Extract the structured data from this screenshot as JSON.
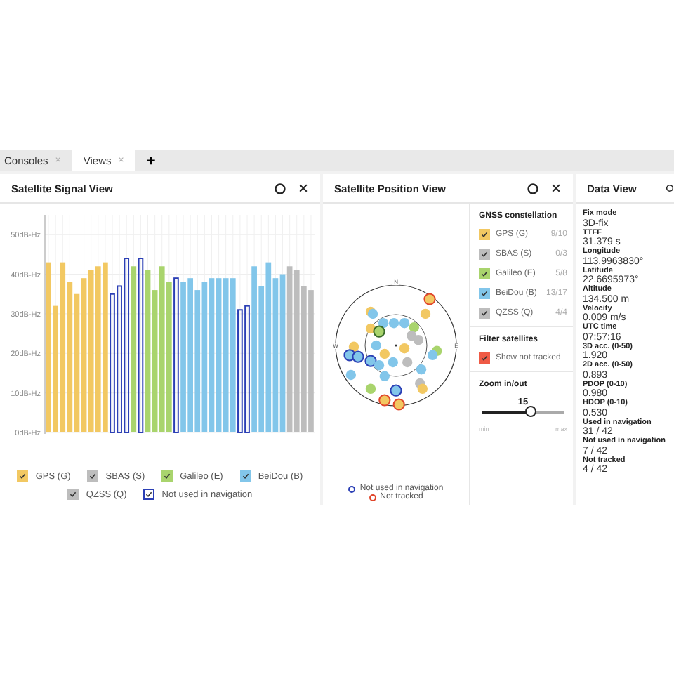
{
  "tabs": [
    {
      "label": "Consoles",
      "close": "×",
      "selected": false
    },
    {
      "label": "Views",
      "close": "×",
      "selected": true
    }
  ],
  "add_tab": "+",
  "signal_view": {
    "title": "Satellite Signal View",
    "chart_data": {
      "type": "bar",
      "ylim": [
        0,
        55
      ],
      "grid": true,
      "yticks": [
        {
          "value": 0,
          "label": "0dB-Hz"
        },
        {
          "value": 10,
          "label": "10dB-Hz"
        },
        {
          "value": 20,
          "label": "20dB-Hz"
        },
        {
          "value": 30,
          "label": "30dB-Hz"
        },
        {
          "value": 40,
          "label": "40dB-Hz"
        },
        {
          "value": 50,
          "label": "50dB-Hz"
        }
      ],
      "stacked": true,
      "series": [
        {
          "name": "GPS (G)",
          "color": "#f2c862",
          "values": [
            43,
            32,
            43,
            38,
            35,
            39,
            41,
            42,
            43,
            null,
            null,
            null,
            null,
            null,
            null,
            null,
            null,
            null,
            null,
            null,
            null,
            null,
            null,
            null,
            null,
            null,
            null,
            null,
            null,
            null,
            null,
            null,
            null,
            null,
            null,
            null,
            null,
            null
          ]
        },
        {
          "name": "SBAS (S)",
          "color": "#bdbdbd",
          "values": [
            null,
            null,
            null,
            null,
            null,
            null,
            null,
            null,
            null,
            null,
            null,
            null,
            null,
            null,
            null,
            null,
            null,
            null,
            null,
            null,
            null,
            null,
            null,
            null,
            null,
            null,
            null,
            null,
            null,
            null,
            null,
            null,
            null,
            null,
            null,
            null,
            null,
            null
          ]
        },
        {
          "name": "Galileo (E)",
          "color": "#a9d46d",
          "values": [
            null,
            null,
            null,
            null,
            null,
            null,
            null,
            null,
            null,
            null,
            null,
            null,
            42,
            null,
            41,
            36,
            42,
            38,
            null,
            null,
            null,
            null,
            null,
            null,
            null,
            null,
            null,
            null,
            null,
            null,
            null,
            null,
            null,
            null,
            null,
            null,
            null,
            null
          ]
        },
        {
          "name": "BeiDou (B)",
          "color": "#82c6ea",
          "values": [
            null,
            null,
            null,
            null,
            null,
            null,
            null,
            null,
            null,
            null,
            null,
            null,
            null,
            null,
            null,
            null,
            null,
            null,
            null,
            38,
            39,
            36,
            38,
            39,
            39,
            39,
            39,
            null,
            null,
            42,
            37,
            43,
            39,
            40,
            null,
            null,
            null,
            null
          ]
        },
        {
          "name": "QZSS (Q)",
          "color": "#bdbdbd",
          "values": [
            null,
            null,
            null,
            null,
            null,
            null,
            null,
            null,
            null,
            null,
            null,
            null,
            null,
            null,
            null,
            null,
            null,
            null,
            null,
            null,
            null,
            null,
            null,
            null,
            null,
            null,
            null,
            null,
            null,
            null,
            null,
            null,
            null,
            null,
            42,
            41,
            37,
            36
          ]
        },
        {
          "name": "Not used in navigation",
          "color": "#2b3fb5",
          "values": [
            null,
            null,
            null,
            null,
            null,
            null,
            null,
            null,
            null,
            35,
            37,
            44,
            null,
            44,
            null,
            null,
            null,
            null,
            39,
            null,
            null,
            null,
            null,
            null,
            null,
            null,
            null,
            31,
            32,
            null,
            null,
            null,
            null,
            null,
            null,
            null,
            null,
            null
          ]
        }
      ]
    },
    "legend": [
      {
        "kind": "fill",
        "checked": true
      },
      {
        "kind": "fill",
        "checked": true
      },
      {
        "kind": "fill",
        "checked": true
      },
      {
        "kind": "fill",
        "checked": true
      },
      {
        "kind": "fill",
        "checked": true
      },
      {
        "kind": "outline",
        "checked": true
      }
    ]
  },
  "position_view": {
    "title": "Satellite Position View",
    "compass": {
      "north": "N",
      "east": "E",
      "west": "W"
    },
    "legend": [
      {
        "label": "Not used in navigation",
        "color": "#2b3fb5"
      },
      {
        "label": "Not tracked",
        "color": "#e0452a"
      }
    ],
    "constellation": {
      "title": "GNSS constellation",
      "items": [
        {
          "label": "GPS (G)",
          "count": "9/10",
          "color": "#f2c862",
          "checked": true
        },
        {
          "label": "SBAS (S)",
          "count": "0/3",
          "color": "#bdbdbd",
          "checked": true
        },
        {
          "label": "Galileo (E)",
          "count": "5/8",
          "color": "#a9d46d",
          "checked": true
        },
        {
          "label": "BeiDou (B)",
          "count": "13/17",
          "color": "#82c6ea",
          "checked": true
        },
        {
          "label": "QZSS (Q)",
          "count": "4/4",
          "color": "#bdbdbd",
          "checked": true
        }
      ]
    },
    "filter": {
      "title": "Filter satellites",
      "items": [
        {
          "label": "Show not tracked",
          "color": "#ef5a45",
          "checked": true
        }
      ]
    },
    "zoom": {
      "title": "Zoom in/out",
      "value": "15",
      "level": 0.6,
      "min": "min",
      "max": "max"
    }
  },
  "data_view": {
    "title": "Data View",
    "fields": [
      {
        "label": "Fix mode",
        "value": "3D-fix"
      },
      {
        "label": "TTFF",
        "value": "31.379 s"
      },
      {
        "label": "Longitude",
        "value": "113.9963830°"
      },
      {
        "label": "Latitude",
        "value": "22.6695973°"
      },
      {
        "label": "Altitude",
        "value": "134.500 m"
      },
      {
        "label": "Velocity",
        "value": "0.009 m/s"
      },
      {
        "label": "UTC time",
        "value": "07:57:16"
      },
      {
        "label": "3D acc. (0-50)",
        "value": "1.920"
      },
      {
        "label": "2D acc. (0-50)",
        "value": "0.893"
      },
      {
        "label": "PDOP (0-10)",
        "value": "0.980"
      },
      {
        "label": "HDOP (0-10)",
        "value": "0.530"
      },
      {
        "label": "Used in navigation",
        "value": "31 / 42"
      },
      {
        "label": "Not used in navigation",
        "value": "7 / 42"
      },
      {
        "label": "Not tracked",
        "value": "4 / 42"
      }
    ]
  }
}
